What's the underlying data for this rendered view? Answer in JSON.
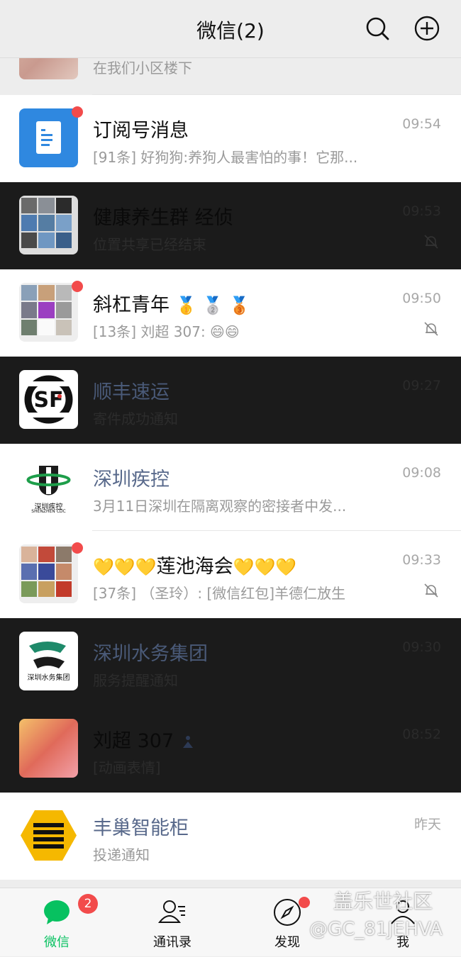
{
  "header": {
    "title": "微信(2)",
    "search_icon": "search-icon",
    "add_icon": "plus-circle-icon"
  },
  "chats": [
    {
      "id": "partial",
      "preview": "在我们小区楼下"
    },
    {
      "id": "subscription",
      "name": "订阅号消息",
      "preview": "[91条] 好狗狗:养狗人最害怕的事！它那...",
      "time": "09:54",
      "unread_dot": true,
      "muted": false
    },
    {
      "id": "health-group",
      "name": "健康养生群  经侦",
      "preview": "位置共享已经结束",
      "time": "09:53",
      "muted": true
    },
    {
      "id": "xiegang",
      "name": "斜杠青年",
      "name_emoji": "🥇 🥈 🥉",
      "preview": "[13条] 刘超  307: ",
      "preview_emoji": "😄😄",
      "time": "09:50",
      "unread_dot": true,
      "muted": true
    },
    {
      "id": "sf",
      "name": "顺丰速运",
      "preview": "寄件成功通知",
      "time": "09:27"
    },
    {
      "id": "szcdc",
      "name": "深圳疾控",
      "preview": "3月11日深圳在隔离观察的密接者中发...",
      "time": "09:08",
      "logo_text": "深圳疾控",
      "logo_sub": "SHENZHEN CDC"
    },
    {
      "id": "lianchi",
      "name_prefix": "💛💛💛",
      "name": "莲池海会",
      "name_suffix": "💛💛💛",
      "preview": "[37条] （圣玲）: [微信红包]羊德仁放生",
      "time": "09:33",
      "unread_dot": true,
      "muted": true
    },
    {
      "id": "water",
      "name": "深圳水务集团",
      "preview": "服务提醒通知",
      "time": "09:30",
      "logo_text": "深圳水务集团"
    },
    {
      "id": "liuchao",
      "name": "刘超  307",
      "preview": "[动画表情]",
      "time": "08:52"
    },
    {
      "id": "fengchao",
      "name": "丰巢智能柜",
      "preview": "投递通知",
      "time": "昨天"
    }
  ],
  "tabs": [
    {
      "label": "微信",
      "badge": "2",
      "icon": "chat-bubble-icon",
      "active": true
    },
    {
      "label": "通讯录",
      "icon": "contacts-icon"
    },
    {
      "label": "发现",
      "icon": "compass-icon",
      "dot": true
    },
    {
      "label": "我",
      "icon": "person-icon"
    }
  ],
  "watermark": {
    "line1": "盖乐世社区",
    "line2": "@GC_81JEHVA"
  },
  "colors": {
    "accent": "#07c160",
    "badge": "#f24b4b",
    "link_name": "#58698b"
  }
}
